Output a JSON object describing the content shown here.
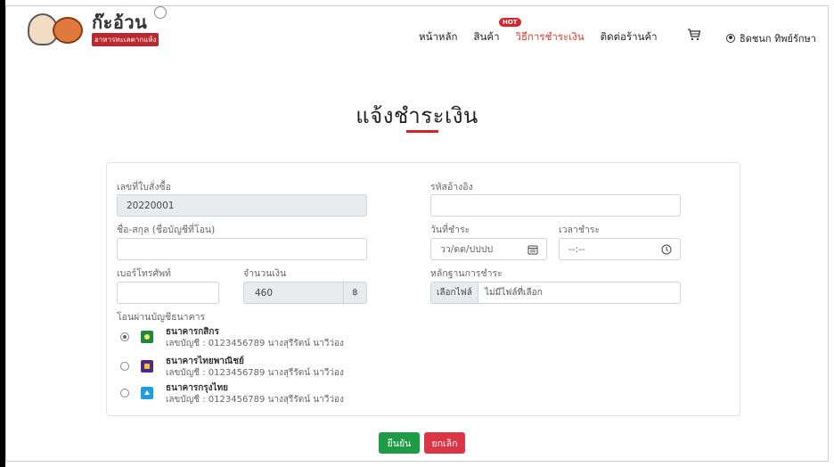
{
  "header": {
    "logo_title": "ก๊ะอ้วน",
    "logo_subtitle": "อาหารทะเลตากแห้ง",
    "nav": [
      {
        "label": "หน้าหลัก",
        "active": false
      },
      {
        "label": "สินค้า",
        "active": false
      },
      {
        "label": "วิธีการชำระเงิน",
        "active": true
      },
      {
        "label": "ติดต่อร้านค้า",
        "active": false
      }
    ],
    "hot_badge": "HOT",
    "user_name": "ธิดชนก ทิพย์รักษา"
  },
  "page": {
    "title": "แจ้งชำระเงิน"
  },
  "form": {
    "order_no_label": "เลขที่ใบสั่งซื้อ",
    "order_no_value": "20220001",
    "ref_label": "รหัสอ้างอิง",
    "ref_value": "",
    "name_label": "ชื่อ-สกุล (ชื่อบัญชีที่โอน)",
    "name_value": "",
    "pay_date_label": "วันที่ชำระ",
    "pay_date_placeholder": "วว/ดด/ปปปป",
    "pay_time_label": "เวลาชำระ",
    "pay_time_placeholder": "--:--",
    "phone_label": "เบอร์โทรศัพท์",
    "phone_value": "",
    "amount_label": "จำนวนเงิน",
    "amount_value": "460",
    "amount_suffix": "฿",
    "evidence_label": "หลักฐานการชำระ",
    "file_button": "เลือกไฟล์",
    "file_status": "ไม่มีไฟล์ที่เลือก",
    "bank_section_label": "โอนผ่านบัญชีธนาคาร",
    "banks": [
      {
        "name": "ธนาคารกสิกร",
        "account": "เลขบัญชี : 0123456789 นางสุรีรัตน์ นาวีว่อง",
        "selected": true,
        "color": "#1b8a3c"
      },
      {
        "name": "ธนาคารไทยพาณิชย์",
        "account": "เลขบัญชี : 0123456789 นางสุรีรัตน์ นาวีว่อง",
        "selected": false,
        "color": "#4e2a84"
      },
      {
        "name": "ธนาคารกรุงไทย",
        "account": "เลขบัญชี : 0123456789 นางสุรีรัตน์ นาวีว่อง",
        "selected": false,
        "color": "#1ba0dc"
      }
    ]
  },
  "actions": {
    "confirm_label": "ยืนยัน",
    "cancel_label": "ยกเลิก"
  },
  "colors": {
    "accent": "#d8232a",
    "confirm": "#1e9b45",
    "cancel": "#dc3545"
  }
}
